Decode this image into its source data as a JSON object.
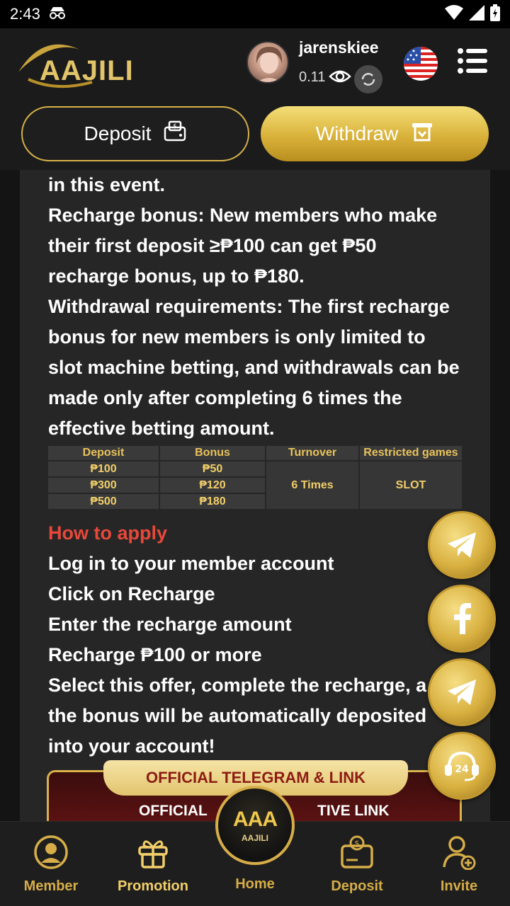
{
  "status_bar": {
    "time": "2:43"
  },
  "header": {
    "logo_text": "AAJILI",
    "username": "jarenskiee",
    "balance": "0.11"
  },
  "actions": {
    "deposit_label": "Deposit",
    "withdraw_label": "Withdraw"
  },
  "event": {
    "lines": [
      "in this event.",
      "Recharge bonus: New members who make",
      "their first deposit ≥₱100 can get ₱50",
      "recharge bonus, up to ₱180.",
      "Withdrawal requirements: The first recharge",
      "bonus for new members is only limited to",
      "slot machine betting, and withdrawals can be",
      "made only after completing 6 times the",
      "effective betting amount."
    ]
  },
  "bonus_table": {
    "headers": [
      "Deposit",
      "Bonus",
      "Turnover",
      "Restricted games"
    ],
    "rows": [
      [
        "₱100",
        "₱50"
      ],
      [
        "₱300",
        "₱120"
      ],
      [
        "₱500",
        "₱180"
      ]
    ],
    "turnover": "6 Times",
    "restricted": "SLOT"
  },
  "how_to_apply": {
    "title": "How to apply",
    "lines": [
      "Log in to your member account",
      "Click on Recharge",
      "Enter the recharge amount",
      "Recharge ₱100 or more",
      "Select this offer, complete the recharge, a",
      "the bonus will be automatically deposited",
      "into your account!"
    ]
  },
  "banner": {
    "title": "OFFICIAL TELEGRAM & LINK",
    "sub_left": "OFFICIAL",
    "sub_right": "TIVE LINK"
  },
  "fabs": [
    "telegram-icon",
    "facebook-icon",
    "telegram-icon",
    "support-24-icon"
  ],
  "support_label": "24",
  "bottom_nav": {
    "member": "Member",
    "promotion": "Promotion",
    "home": "Home",
    "home_logo": "AAA",
    "home_logo_sub": "AAJILI",
    "deposit": "Deposit",
    "invite": "Invite"
  },
  "colors": {
    "gold": "#d6ad48",
    "accent_red": "#e8483a",
    "background": "#141414",
    "panel": "#262626"
  }
}
